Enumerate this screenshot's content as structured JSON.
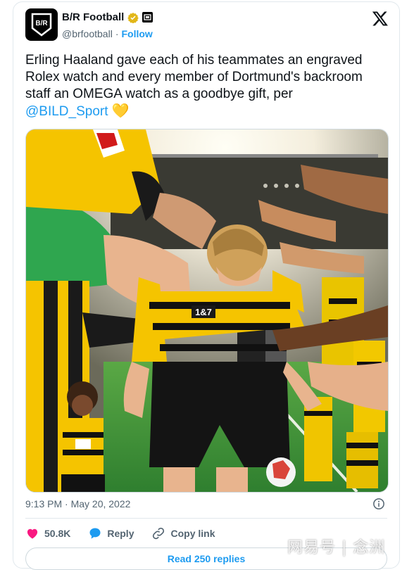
{
  "account": {
    "name": "B/R Football",
    "handle": "@brfootball",
    "separator": "·",
    "follow_label": "Follow"
  },
  "tweet": {
    "text": "Erling Haaland gave each of his teammates an engraved Rolex watch and every member of Dortmund's backroom staff an OMEGA watch as a goodbye gift, per",
    "mention": "@BILD_Sport",
    "emoji": "💛"
  },
  "photo": {
    "shirt_sponsor": "1&7"
  },
  "meta": {
    "timestamp": "9:13 PM · May 20, 2022"
  },
  "actions": {
    "like_count": "50.8K",
    "reply_label": "Reply",
    "copy_label": "Copy link"
  },
  "read_replies_label": "Read 250 replies",
  "watermark": "网易号 | 念洲",
  "colors": {
    "accent": "#1d9bf0",
    "like": "#f91880",
    "dortmund_yellow": "#f5d400",
    "dortmund_black": "#111111",
    "pitch_green": "#3f9a3b"
  },
  "icons": [
    "verified-badge-icon",
    "affiliate-badge-icon",
    "x-logo-icon",
    "info-icon",
    "heart-icon",
    "reply-icon",
    "link-icon"
  ]
}
